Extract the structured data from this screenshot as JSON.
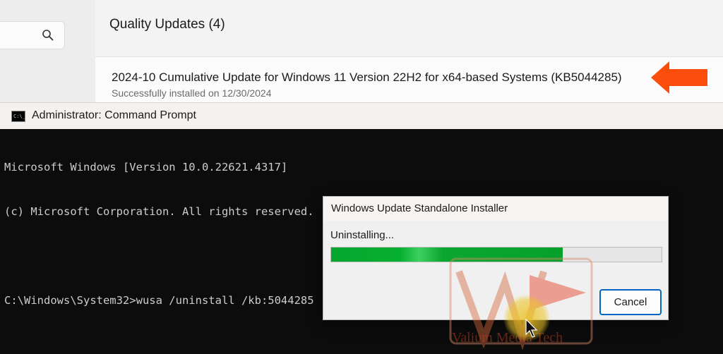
{
  "settings": {
    "section_title": "Quality Updates (4)",
    "update": {
      "title": "2024-10 Cumulative Update for Windows 11 Version 22H2 for x64-based Systems (KB5044285)",
      "status": "Successfully installed on 12/30/2024"
    }
  },
  "cmd": {
    "window_title": "Administrator: Command Prompt",
    "icon_text": "C:\\_",
    "lines": [
      "Microsoft Windows [Version 10.0.22621.4317]",
      "(c) Microsoft Corporation. All rights reserved.",
      "",
      "C:\\Windows\\System32>wusa /uninstall /kb:5044285"
    ]
  },
  "dialog": {
    "title": "Windows Update Standalone Installer",
    "status_text": "Uninstalling...",
    "progress": 0.7,
    "cancel_label": "Cancel"
  },
  "watermark": {
    "text": "Valium Media Tech"
  },
  "colors": {
    "arrow": "#fb4d0c",
    "progress_fill": "#06a62c",
    "button_border": "#0067c0"
  },
  "icons": [
    "search-icon",
    "cmd-icon",
    "arrow-pointer-icon",
    "mouse-cursor-icon"
  ]
}
